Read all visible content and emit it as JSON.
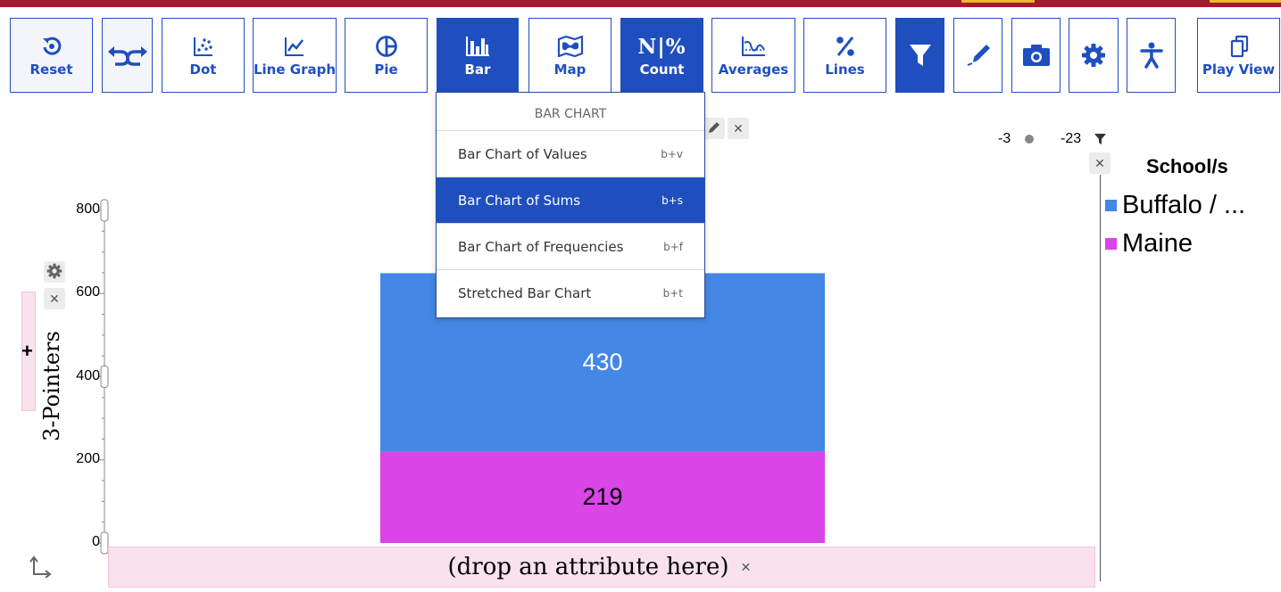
{
  "toolbar": {
    "reset": "Reset",
    "dot": "Dot",
    "line_graph": "Line Graph",
    "pie": "Pie",
    "bar": "Bar",
    "map": "Map",
    "count_icon": "N|%",
    "count": "Count",
    "averages": "Averages",
    "lines": "Lines",
    "play_view": "Play View"
  },
  "bar_menu": {
    "title": "BAR CHART",
    "items": [
      {
        "label": "Bar Chart of Values",
        "shortcut": "b+v"
      },
      {
        "label": "Bar Chart of Sums",
        "shortcut": "b+s",
        "selected": true
      },
      {
        "label": "Bar Chart of Frequencies",
        "shortcut": "b+f"
      },
      {
        "label": "Stretched Bar Chart",
        "shortcut": "b+t"
      }
    ]
  },
  "filter_readout": {
    "dot_value": "-3",
    "filter_value": "-23"
  },
  "legend": {
    "title": "School/s",
    "items": [
      {
        "label": "Buffalo / ...",
        "color": "#4487e4"
      },
      {
        "label": "Maine",
        "color": "#d945e6"
      }
    ]
  },
  "drop_zone": {
    "text": "(drop an attribute here)"
  },
  "chart_data": {
    "type": "bar",
    "stacked": true,
    "ylabel": "3-Pointers",
    "ylim": [
      0,
      800
    ],
    "yticks": [
      "0",
      "200",
      "400",
      "600",
      "800"
    ],
    "series": [
      {
        "name": "Maine",
        "values": [
          219
        ],
        "color": "#d945e6"
      },
      {
        "name": "Buffalo / ...",
        "values": [
          430
        ],
        "color": "#4487e4"
      }
    ]
  }
}
